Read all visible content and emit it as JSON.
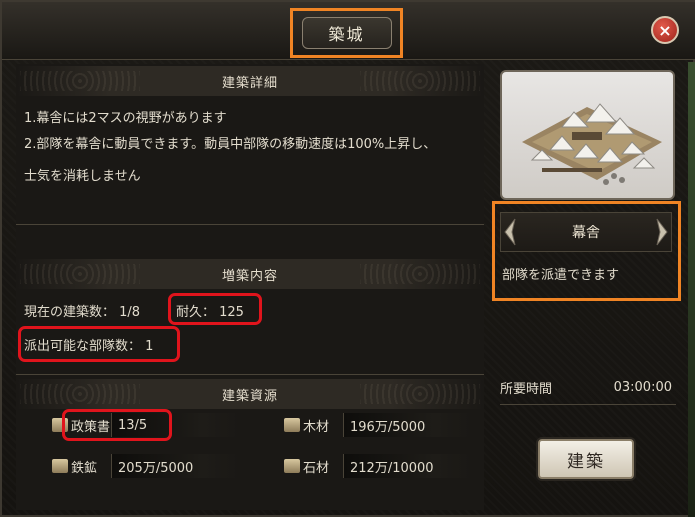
{
  "window": {
    "title": "築城",
    "close_label": "×"
  },
  "details": {
    "header": "建築詳細",
    "lines": [
      "1.幕舎には2マスの視野があります",
      "2.部隊を幕舎に動員できます。動員中部隊の移動速度は100%上昇し、",
      "士気を消耗しません"
    ]
  },
  "upgrade": {
    "header": "増築内容",
    "built_count": "現在の建築数： 1/8",
    "durability": "耐久： 125",
    "dispatchable": "派出可能な部隊数： 1"
  },
  "resources": {
    "header": "建築資源",
    "items": [
      {
        "label": "政策書",
        "value": "13/5"
      },
      {
        "label": "木材",
        "value": "196万/5000"
      },
      {
        "label": "鉄鉱",
        "value": "205万/5000"
      },
      {
        "label": "石材",
        "value": "212万/10000"
      }
    ]
  },
  "building": {
    "name": "幕舎",
    "description": "部隊を派遣できます"
  },
  "time": {
    "label": "所要時間",
    "value": "03:00:00"
  },
  "actions": {
    "build_label": "建築"
  },
  "colors": {
    "highlight_orange": "#f08424",
    "highlight_red": "#e0141c",
    "close_red": "#c0392b"
  }
}
